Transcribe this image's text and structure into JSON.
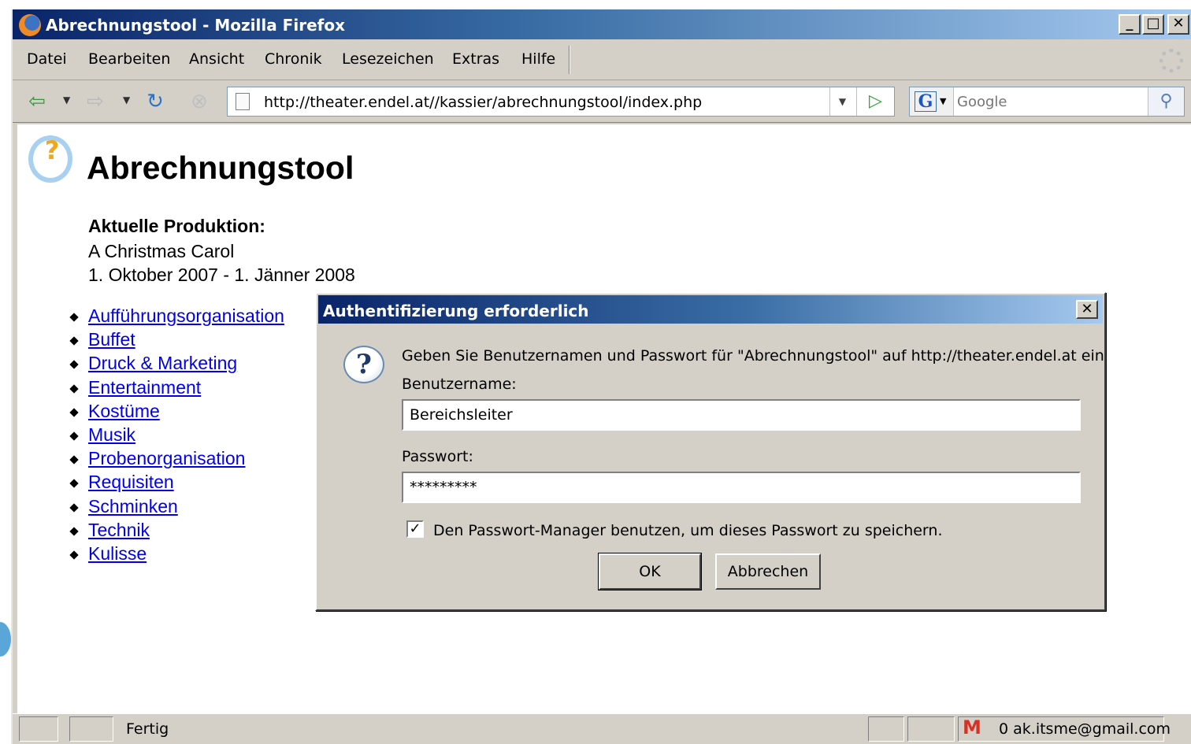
{
  "window": {
    "title": "Abrechnungstool - Mozilla Firefox",
    "minimize": "_",
    "maximize": "□",
    "close": "✕"
  },
  "menu": {
    "items": [
      "Datei",
      "Bearbeiten",
      "Ansicht",
      "Chronik",
      "Lesezeichen",
      "Extras",
      "Hilfe"
    ]
  },
  "navbar": {
    "back_icon": "back-arrow-icon",
    "forward_icon": "forward-arrow-icon",
    "reload_icon": "reload-icon",
    "stop_icon": "stop-icon",
    "url": "http://theater.endel.at//kassier/abrechnungstool/index.php",
    "search_placeholder": "Google"
  },
  "page": {
    "title": "Abrechnungstool",
    "production_label": "Aktuelle Produktion:",
    "production_name": "A Christmas Carol",
    "production_dates": "1. Oktober 2007 - 1. Jänner 2008",
    "links": [
      "Aufführungsorganisation",
      "Buffet",
      "Druck & Marketing",
      "Entertainment",
      "Kostüme",
      "Musik",
      "Probenorganisation",
      "Requisiten",
      "Schminken",
      "Technik",
      "Kulisse"
    ]
  },
  "dialog": {
    "title": "Authentifizierung erforderlich",
    "close": "✕",
    "message": "Geben Sie Benutzernamen und Passwort für \"Abrechnungstool\" auf http://theater.endel.at ein",
    "username_label": "Benutzername:",
    "username_value": "Bereichsleiter",
    "password_label": "Passwort:",
    "password_value": "*********",
    "remember_checked": true,
    "remember_mark": "✓",
    "remember_label": "Den Passwort-Manager benutzen, um dieses Passwort zu speichern.",
    "ok_label": "OK",
    "cancel_label": "Abbrechen"
  },
  "statusbar": {
    "text": "Fertig",
    "mail": "0 ak.itsme@gmail.com",
    "gmail_letter": "M"
  },
  "colors": {
    "titlebar_start": "#0a246a",
    "titlebar_end": "#a6caf0",
    "link": "#0000ee",
    "chrome": "#d4d0c8"
  }
}
